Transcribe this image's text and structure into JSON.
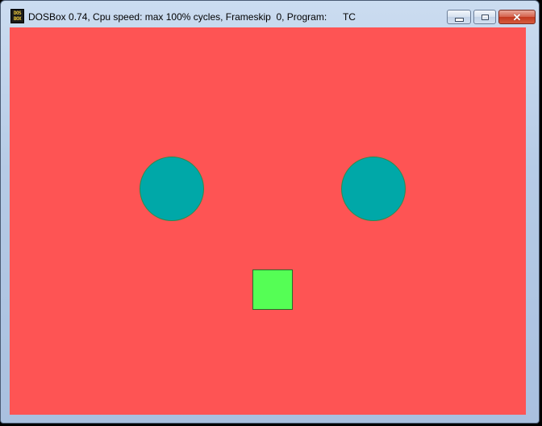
{
  "window": {
    "title": "DOSBox 0.74, Cpu speed: max 100% cycles, Frameskip  0, Program:      TC",
    "icon_top": "DOS",
    "icon_bottom": "BOX",
    "controls": {
      "minimize_icon": "minimize-icon",
      "maximize_icon": "maximize-icon",
      "close_icon": "close-icon",
      "close_glyph": "✕"
    }
  },
  "canvas": {
    "background_color": "#fe5454",
    "shapes": [
      {
        "name": "left-eye",
        "shape": "circle",
        "color": "#00a8a8"
      },
      {
        "name": "right-eye",
        "shape": "circle",
        "color": "#00a8a8"
      },
      {
        "name": "mouth",
        "shape": "square",
        "color": "#55fe55"
      }
    ]
  }
}
